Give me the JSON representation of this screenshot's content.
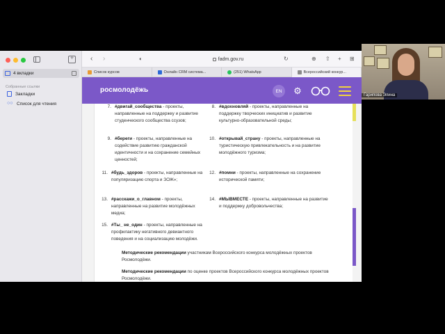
{
  "sidebar": {
    "tabs_label": "4 вкладки",
    "section_title": "Собранные ссылки",
    "items": [
      {
        "label": "Закладки",
        "icon": "bookmark-icon"
      },
      {
        "label": "Список для чтения",
        "icon": "glasses-icon"
      }
    ]
  },
  "toolbar": {
    "url": "fadm.gov.ru"
  },
  "tabs": [
    {
      "label": "Список курсов",
      "icon": "orange-favicon"
    },
    {
      "label": "Онлайн CRM система...",
      "icon": "blue-favicon"
    },
    {
      "label": "(251) WhatsApp",
      "icon": "whatsapp-favicon"
    },
    {
      "label": "Всероссийский конкур...",
      "icon": "gray-favicon"
    }
  ],
  "site": {
    "logo": "росмолодёжь",
    "lang_button": "EN",
    "colors": {
      "header": "#7b58c8",
      "menu": "#f1d23e"
    }
  },
  "content": {
    "items": [
      {
        "num": "7.",
        "tag": "#двигай_сообщества",
        "text": " - проекты, направленные на поддержку и развитие студенческого сообщества ссузов;"
      },
      {
        "num": "8.",
        "tag": "#вдохновляй",
        "text": " - проекты, направленные на поддержку творческих инициатив и развитие культурно-образовательной среды;"
      },
      {
        "num": "9.",
        "tag": "#береги",
        "text": " - проекты, направленные на содействие развитию гражданской идентичности и на сохранение семейных ценностей;"
      },
      {
        "num": "10.",
        "tag": "#открывай_страну",
        "text": " - проекты, направленные на туристическую привлекательность и на развитие молодёжного туризма;"
      },
      {
        "num": "11.",
        "tag": "#будь_здоров",
        "text": " - проекты, направленные на популяризацию спорта и ЗОЖ»;"
      },
      {
        "num": "12.",
        "tag": "#помни",
        "text": " - проекты, направленные на сохранение исторической памяти;"
      },
      {
        "num": "13.",
        "tag": "#расскажи_о_главном",
        "text": " - проекты, направленные на развитие молодёжных медиа;"
      },
      {
        "num": "14.",
        "tag": "#МЫВМЕСТЕ",
        "text": " - проекты, направленные на развитие и поддержку добровольчества;"
      },
      {
        "num": "15.",
        "tag": "#Ты_ не_один",
        "text": " - проекты, направленные на профилактику негативного девиантного поведения и на социализацию молодёжи."
      }
    ],
    "para1_bold": "Методические рекомендации",
    "para1_text": " участникам Всероссийского конкурса молодёжных проектов Росмолодёжи.",
    "para2_bold": "Методические рекомендации",
    "para2_text": " по оценке проектов Всероссийского конкурса молодёжных проектов Росмолодёжи."
  },
  "video": {
    "participant_name": "Гарипова Элина"
  }
}
